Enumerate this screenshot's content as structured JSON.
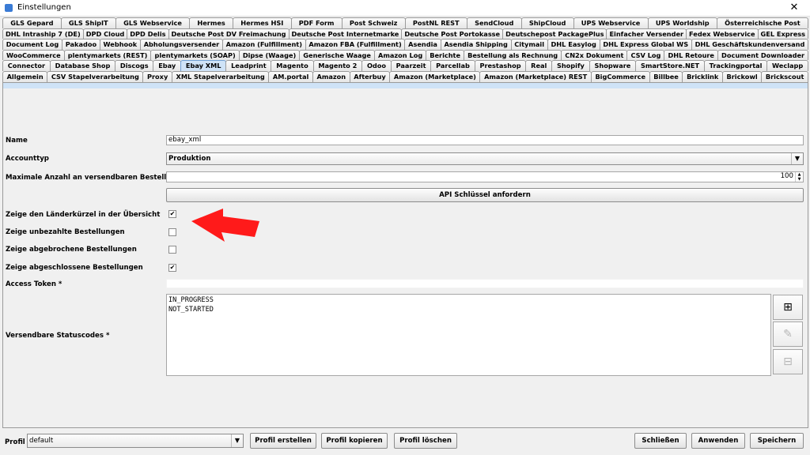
{
  "window": {
    "title": "Einstellungen",
    "close_glyph": "✕"
  },
  "tabs": {
    "rows": [
      [
        "GLS Gepard",
        "GLS ShipIT",
        "GLS Webservice",
        "Hermes",
        "Hermes HSI",
        "PDF Form",
        "Post Schweiz",
        "PostNL REST",
        "SendCloud",
        "ShipCloud",
        "UPS Webservice",
        "UPS Worldship",
        "Österreichische Post"
      ],
      [
        "DHL Intraship 7 (DE)",
        "DPD Cloud",
        "DPD Delis",
        "Deutsche Post DV Freimachung",
        "Deutsche Post Internetmarke",
        "Deutsche Post Portokasse",
        "Deutschepost PackagePlus",
        "Einfacher Versender",
        "Fedex Webservice",
        "GEL Express"
      ],
      [
        "Document Log",
        "Pakadoo",
        "Webhook",
        "Abholungsversender",
        "Amazon (Fulfillment)",
        "Amazon FBA (Fulfillment)",
        "Asendia",
        "Asendia Shipping",
        "Citymail",
        "DHL Easylog",
        "DHL Express Global WS",
        "DHL Geschäftskundenversand"
      ],
      [
        "WooCommerce",
        "plentymarkets (REST)",
        "plentymarkets (SOAP)",
        "Dipse (Waage)",
        "Generische Waage",
        "Amazon Log",
        "Berichte",
        "Bestellung als Rechnung",
        "CN2x Dokument",
        "CSV Log",
        "DHL Retoure",
        "Document Downloader"
      ],
      [
        "Connector",
        "Database Shop",
        "Discogs",
        "Ebay",
        "Ebay XML",
        "Leadprint",
        "Magento",
        "Magento 2",
        "Odoo",
        "Paarzeit",
        "Parcellab",
        "Prestashop",
        "Real",
        "Shopify",
        "Shopware",
        "SmartStore.NET",
        "Trackingportal",
        "Weclapp"
      ],
      [
        "Allgemein",
        "CSV Stapelverarbeitung",
        "Proxy",
        "XML Stapelverarbeitung",
        "AM.portal",
        "Amazon",
        "Afterbuy",
        "Amazon (Marketplace)",
        "Amazon (Marketplace) REST",
        "BigCommerce",
        "Billbee",
        "Bricklink",
        "Brickowl",
        "Brickscout"
      ]
    ],
    "active": "Ebay XML"
  },
  "form": {
    "name_label": "Name",
    "name_value": "ebay_xml",
    "accounttyp_label": "Accounttyp",
    "accounttyp_value": "Produktion",
    "max_label": "Maximale Anzahl an versendbaren Bestellungen",
    "max_value": "100",
    "api_button": "API Schlüssel anfordern",
    "cb1_label": "Zeige den Länderkürzel in der Übersicht",
    "cb1_checked": true,
    "cb2_label": "Zeige unbezahlte Bestellungen",
    "cb2_checked": false,
    "cb3_label": "Zeige abgebrochene Bestellungen",
    "cb3_checked": false,
    "cb4_label": "Zeige abgeschlossene Bestellungen",
    "cb4_checked": true,
    "access_token_label": "Access Token *",
    "access_token_value": "",
    "status_label": "Versendbare Statuscodes *",
    "status_codes": [
      "IN_PROGRESS",
      "NOT_STARTED"
    ],
    "add_icon": "plus-icon",
    "edit_icon": "edit-icon",
    "remove_icon": "minus-icon"
  },
  "footer": {
    "profil_label": "Profil",
    "profil_value": "default",
    "create_button": "Profil erstellen",
    "copy_button": "Profil kopieren",
    "delete_button": "Profil löschen",
    "close_button": "Schließen",
    "apply_button": "Anwenden",
    "save_button": "Speichern"
  },
  "colors": {
    "active_tab": "#cfe3f7",
    "arrow": "#ff1a1a"
  }
}
